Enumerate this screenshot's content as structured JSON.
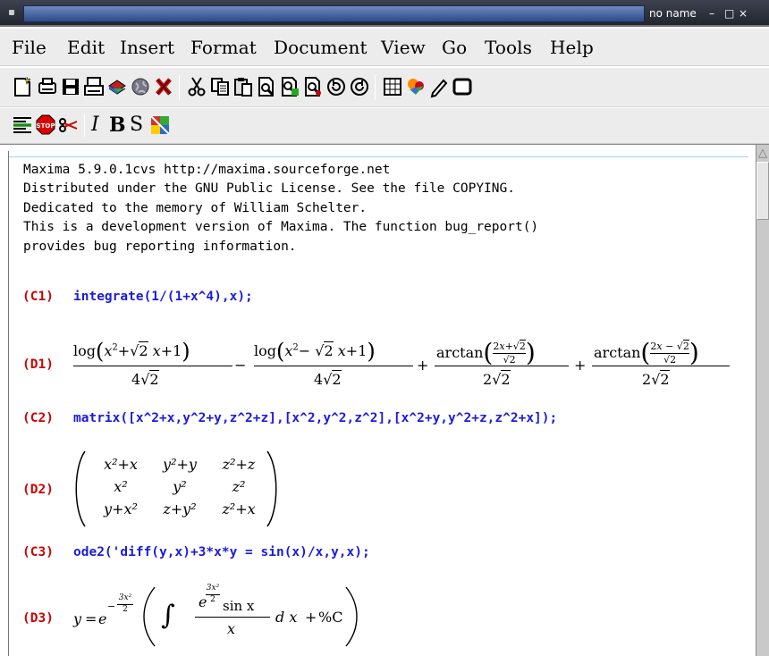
{
  "window": {
    "title": "no name",
    "min": "–",
    "max": "□",
    "close": "×"
  },
  "menu": [
    "File",
    "Edit",
    "Insert",
    "Format",
    "Document",
    "View",
    "Go",
    "Tools",
    "Help"
  ],
  "toolbar2": {
    "italic": "I",
    "bold": "B",
    "sans": "S"
  },
  "banner": [
    "Maxima 5.9.0.1cvs http://maxima.sourceforge.net",
    "Distributed under the GNU Public License. See the file COPYING.",
    "Dedicated to the memory of William Schelter.",
    "This is a development version of Maxima. The function bug_report()",
    "provides bug reporting information."
  ],
  "cells": [
    {
      "in_label": "(C1)",
      "input": "integrate(1/(1+x^4),x);",
      "out_label": "(D1)"
    },
    {
      "in_label": "(C2)",
      "input": "matrix([x^2+x,y^2+y,z^2+z],[x^2,y^2,z^2],[x^2+y,y^2+z,z^2+x]);",
      "out_label": "(D2)"
    },
    {
      "in_label": "(C3)",
      "input": "ode2('diff(y,x)+3*x*y = sin(x)/x,y,x);",
      "out_label": "(D3)"
    }
  ],
  "d1": {
    "t1_num": "log",
    "t1_den": "4",
    "op1": "−",
    "t2_num": "log",
    "t2_den": "4",
    "op2": "+",
    "t3_num": "arctan",
    "t3_den": "2",
    "op3": "+",
    "t4_num": "arctan",
    "t4_den": "2"
  },
  "d2": {
    "rows": [
      [
        "x²+x",
        "y²+y",
        "z²+z"
      ],
      [
        "x²",
        "y²",
        "z²"
      ],
      [
        "y+x²",
        "z+y²",
        "z²+x"
      ]
    ]
  },
  "d3": {
    "lhs": "y",
    "eq": "=",
    "e": "e",
    "exp_num": "3x²",
    "exp_den": "2",
    "int": "∫",
    "num_e": "e",
    "num_exp_num": "3x²",
    "num_exp_den": "2",
    "num_rest": "sin x",
    "den": "x",
    "dx": "d x",
    "plus": "+",
    "const": "%C"
  }
}
